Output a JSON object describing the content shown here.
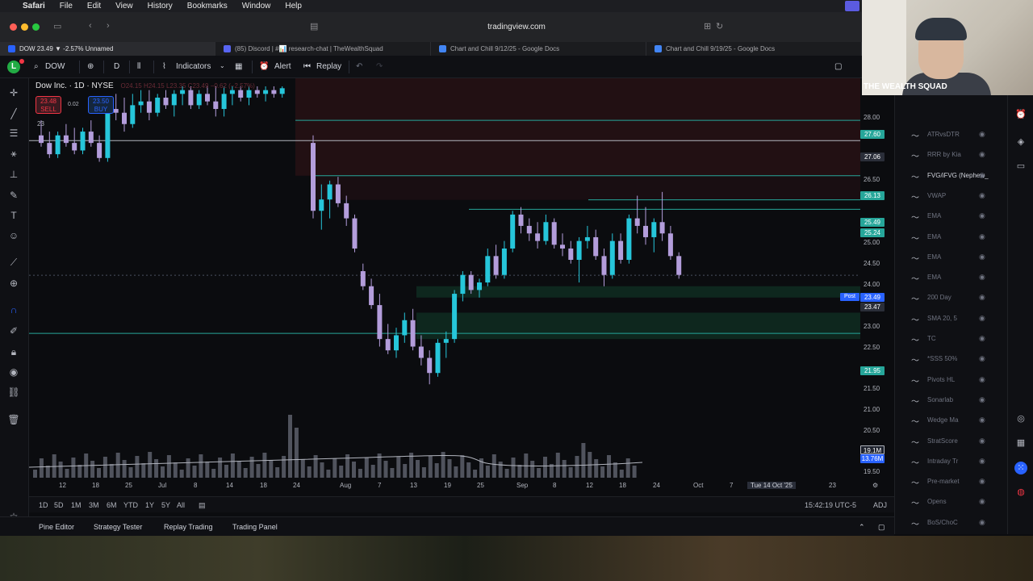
{
  "menubar": {
    "app": "Safari",
    "items": [
      "File",
      "Edit",
      "View",
      "History",
      "Bookmarks",
      "Window",
      "Help"
    ]
  },
  "safari": {
    "url": "tradingview.com"
  },
  "tabs": [
    {
      "label": "DOW 23.49 ▼ -2.57% Unnamed",
      "color": "#2962ff"
    },
    {
      "label": "(85) Discord | #📊 research-chat | TheWealthSquad",
      "color": "#5865f2"
    },
    {
      "label": "Chart and Chill 9/12/25 - Google Docs",
      "color": "#4285f4"
    },
    {
      "label": "Chart and Chill 9/19/25 - Google Docs",
      "color": "#4285f4"
    }
  ],
  "tv": {
    "avatar": "L",
    "symbol": "DOW",
    "interval": "D",
    "indicators": "Indicators",
    "alert": "Alert",
    "replay": "Replay"
  },
  "legend": {
    "name": "Dow Inc. · 1D · NYSE",
    "ohlc": "O24.15 H24.15 L23.35 C23.49 −0.62 (−2.57%)",
    "sell_price": "23.48",
    "sell_label": "SELL",
    "buy_price": "23.50",
    "buy_label": "BUY",
    "spread": "0.02",
    "vol": "23"
  },
  "price_scale": {
    "labels": [
      "28.00",
      "26.50",
      "25.00",
      "24.50",
      "24.00",
      "23.00",
      "22.50",
      "21.50",
      "21.00",
      "20.50",
      "19.50"
    ],
    "tags": [
      {
        "text": "27.60",
        "color": "#26a69a"
      },
      {
        "text": "27.06",
        "color": "#2a2e39"
      },
      {
        "text": "26.13",
        "color": "#26a69a"
      },
      {
        "text": "25.49",
        "color": "#26a69a"
      },
      {
        "text": "25.24",
        "color": "#26a69a"
      },
      {
        "text": "23.49",
        "color": "#2962ff"
      },
      {
        "text": "23.47",
        "color": "#2a2e39"
      },
      {
        "text": "21.95",
        "color": "#26a69a"
      },
      {
        "text": "19.1M",
        "color": "#1e222d"
      },
      {
        "text": "13.76M",
        "color": "#2962ff"
      }
    ],
    "post_label": "Post"
  },
  "time_axis": [
    "12",
    "18",
    "25",
    "Jul",
    "8",
    "14",
    "18",
    "24",
    "Aug",
    "7",
    "13",
    "19",
    "25",
    "Sep",
    "8",
    "12",
    "18",
    "24",
    "Oct",
    "7",
    "Tue 14 Oct '25",
    "23"
  ],
  "range_bar": {
    "ranges": [
      "1D",
      "5D",
      "1M",
      "3M",
      "6M",
      "YTD",
      "1Y",
      "5Y",
      "All"
    ],
    "clock": "15:42:19 UTC-5",
    "adj": "ADJ"
  },
  "bottom_panel": [
    "Pine Editor",
    "Strategy Tester",
    "Replay Trading",
    "Trading Panel"
  ],
  "object_tree": [
    {
      "name": "ATRvsDTR",
      "bright": false
    },
    {
      "name": "RRR by Kia",
      "bright": false
    },
    {
      "name": "FVG/iFVG (Nephew_",
      "bright": true
    },
    {
      "name": "VWAP",
      "bright": false
    },
    {
      "name": "EMA",
      "bright": false
    },
    {
      "name": "EMA",
      "bright": false
    },
    {
      "name": "EMA",
      "bright": false
    },
    {
      "name": "EMA",
      "bright": false
    },
    {
      "name": "200 Day",
      "bright": false
    },
    {
      "name": "SMA 20, 5",
      "bright": false
    },
    {
      "name": "TC",
      "bright": false
    },
    {
      "name": "*SSS 50%",
      "bright": false
    },
    {
      "name": "Pivots HL",
      "bright": false
    },
    {
      "name": "Sonarlab",
      "bright": false
    },
    {
      "name": "Wedge Ma",
      "bright": false
    },
    {
      "name": "StratScore",
      "bright": false
    },
    {
      "name": "Intraday Tr",
      "bright": false
    },
    {
      "name": "Pre-market",
      "bright": false
    },
    {
      "name": "Opens",
      "bright": false
    },
    {
      "name": "BoS/ChoC",
      "bright": false
    }
  ],
  "webcam": {
    "tag": "THE WEALTH SQUAD"
  },
  "colors": {
    "up": "#26c6da",
    "down": "#b39ddb",
    "level": "#26a69a",
    "bg": "#0b0c0f"
  },
  "chart_data": {
    "type": "candlestick",
    "ylim": [
      19.3,
      28.5
    ],
    "candles": [
      {
        "o": 27.2,
        "h": 27.6,
        "l": 26.9,
        "c": 27.0
      },
      {
        "o": 27.0,
        "h": 27.3,
        "l": 26.6,
        "c": 26.7
      },
      {
        "o": 26.7,
        "h": 27.3,
        "l": 26.6,
        "c": 27.2
      },
      {
        "o": 27.2,
        "h": 27.5,
        "l": 26.9,
        "c": 27.0
      },
      {
        "o": 27.0,
        "h": 27.4,
        "l": 26.7,
        "c": 26.8
      },
      {
        "o": 26.8,
        "h": 27.4,
        "l": 26.7,
        "c": 27.3
      },
      {
        "o": 27.3,
        "h": 27.6,
        "l": 26.9,
        "c": 27.0
      },
      {
        "o": 27.0,
        "h": 27.2,
        "l": 26.5,
        "c": 26.6
      },
      {
        "o": 26.6,
        "h": 28.0,
        "l": 26.5,
        "c": 27.9
      },
      {
        "o": 27.9,
        "h": 28.3,
        "l": 27.6,
        "c": 27.8
      },
      {
        "o": 27.8,
        "h": 28.2,
        "l": 27.3,
        "c": 27.5
      },
      {
        "o": 27.5,
        "h": 28.3,
        "l": 27.4,
        "c": 28.0
      },
      {
        "o": 28.0,
        "h": 28.4,
        "l": 27.8,
        "c": 28.1
      },
      {
        "o": 28.1,
        "h": 28.4,
        "l": 27.6,
        "c": 27.8
      },
      {
        "o": 27.8,
        "h": 28.3,
        "l": 27.7,
        "c": 28.2
      },
      {
        "o": 28.2,
        "h": 28.4,
        "l": 27.9,
        "c": 28.0
      },
      {
        "o": 28.0,
        "h": 28.4,
        "l": 27.7,
        "c": 28.3
      },
      {
        "o": 28.3,
        "h": 28.5,
        "l": 28.0,
        "c": 28.4
      },
      {
        "o": 28.4,
        "h": 28.5,
        "l": 27.9,
        "c": 28.0
      },
      {
        "o": 28.0,
        "h": 28.4,
        "l": 27.9,
        "c": 28.3
      },
      {
        "o": 28.3,
        "h": 28.5,
        "l": 28.0,
        "c": 28.1
      },
      {
        "o": 28.1,
        "h": 28.5,
        "l": 27.7,
        "c": 27.9
      },
      {
        "o": 27.9,
        "h": 28.5,
        "l": 27.7,
        "c": 28.3
      },
      {
        "o": 28.3,
        "h": 28.5,
        "l": 28.0,
        "c": 28.4
      },
      {
        "o": 28.4,
        "h": 28.5,
        "l": 28.1,
        "c": 28.2
      },
      {
        "o": 28.2,
        "h": 28.5,
        "l": 28.0,
        "c": 28.4
      },
      {
        "o": 28.4,
        "h": 28.5,
        "l": 28.2,
        "c": 28.3
      },
      {
        "o": 28.3,
        "h": 28.5,
        "l": 28.1,
        "c": 28.4
      },
      {
        "o": 28.4,
        "h": 28.5,
        "l": 28.2,
        "c": 28.3
      },
      {
        "o": 28.3,
        "h": 28.5,
        "l": 28.2,
        "c": 28.45
      },
      {
        "o": 27.0,
        "h": 27.2,
        "l": 25.0,
        "c": 25.2
      },
      {
        "o": 25.2,
        "h": 25.9,
        "l": 24.7,
        "c": 25.5
      },
      {
        "o": 25.5,
        "h": 26.0,
        "l": 25.0,
        "c": 25.9
      },
      {
        "o": 25.9,
        "h": 26.1,
        "l": 25.3,
        "c": 25.4
      },
      {
        "o": 25.4,
        "h": 25.6,
        "l": 24.8,
        "c": 25.0
      },
      {
        "o": 25.0,
        "h": 25.1,
        "l": 24.1,
        "c": 24.2
      },
      {
        "o": 23.6,
        "h": 23.8,
        "l": 23.1,
        "c": 23.2
      },
      {
        "o": 23.2,
        "h": 23.4,
        "l": 22.6,
        "c": 22.7
      },
      {
        "o": 22.7,
        "h": 23.0,
        "l": 21.6,
        "c": 21.8
      },
      {
        "o": 21.8,
        "h": 22.2,
        "l": 21.4,
        "c": 21.5
      },
      {
        "o": 21.5,
        "h": 22.1,
        "l": 21.3,
        "c": 21.9
      },
      {
        "o": 21.9,
        "h": 22.5,
        "l": 21.7,
        "c": 22.3
      },
      {
        "o": 22.3,
        "h": 22.6,
        "l": 21.5,
        "c": 21.6
      },
      {
        "o": 21.6,
        "h": 21.9,
        "l": 21.1,
        "c": 21.3
      },
      {
        "o": 21.3,
        "h": 21.5,
        "l": 20.6,
        "c": 20.9
      },
      {
        "o": 20.9,
        "h": 21.8,
        "l": 20.8,
        "c": 21.7
      },
      {
        "o": 21.7,
        "h": 22.0,
        "l": 21.3,
        "c": 21.8
      },
      {
        "o": 21.8,
        "h": 23.1,
        "l": 21.7,
        "c": 23.0
      },
      {
        "o": 23.0,
        "h": 23.6,
        "l": 22.8,
        "c": 23.5
      },
      {
        "o": 23.5,
        "h": 23.6,
        "l": 23.0,
        "c": 23.1
      },
      {
        "o": 23.1,
        "h": 23.4,
        "l": 22.9,
        "c": 23.3
      },
      {
        "o": 23.3,
        "h": 24.2,
        "l": 23.2,
        "c": 24.0
      },
      {
        "o": 24.0,
        "h": 24.3,
        "l": 23.4,
        "c": 23.5
      },
      {
        "o": 23.5,
        "h": 24.4,
        "l": 23.4,
        "c": 24.2
      },
      {
        "o": 24.2,
        "h": 25.2,
        "l": 24.1,
        "c": 25.1
      },
      {
        "o": 25.1,
        "h": 25.3,
        "l": 24.6,
        "c": 24.8
      },
      {
        "o": 24.8,
        "h": 25.0,
        "l": 24.4,
        "c": 24.6
      },
      {
        "o": 24.6,
        "h": 24.9,
        "l": 24.2,
        "c": 24.4
      },
      {
        "o": 24.4,
        "h": 25.1,
        "l": 24.3,
        "c": 24.9
      },
      {
        "o": 24.9,
        "h": 25.0,
        "l": 24.2,
        "c": 24.3
      },
      {
        "o": 24.3,
        "h": 24.6,
        "l": 24.0,
        "c": 24.2
      },
      {
        "o": 24.2,
        "h": 24.4,
        "l": 23.8,
        "c": 23.9
      },
      {
        "o": 23.9,
        "h": 24.5,
        "l": 23.3,
        "c": 24.4
      },
      {
        "o": 24.4,
        "h": 24.8,
        "l": 24.2,
        "c": 24.5
      },
      {
        "o": 24.5,
        "h": 24.7,
        "l": 23.9,
        "c": 24.0
      },
      {
        "o": 24.0,
        "h": 24.2,
        "l": 23.2,
        "c": 23.5
      },
      {
        "o": 23.5,
        "h": 24.6,
        "l": 23.4,
        "c": 24.4
      },
      {
        "o": 24.4,
        "h": 24.6,
        "l": 23.8,
        "c": 23.9
      },
      {
        "o": 23.9,
        "h": 25.1,
        "l": 23.8,
        "c": 25.0
      },
      {
        "o": 25.0,
        "h": 25.6,
        "l": 24.6,
        "c": 24.8
      },
      {
        "o": 24.8,
        "h": 25.3,
        "l": 24.3,
        "c": 24.5
      },
      {
        "o": 24.5,
        "h": 25.0,
        "l": 24.1,
        "c": 24.9
      },
      {
        "o": 24.9,
        "h": 25.7,
        "l": 24.4,
        "c": 24.6
      },
      {
        "o": 24.6,
        "h": 24.8,
        "l": 23.9,
        "c": 24.0
      },
      {
        "o": 24.0,
        "h": 24.1,
        "l": 23.4,
        "c": 23.5
      }
    ],
    "levels": [
      {
        "price": 27.6,
        "color": "#26a69a"
      },
      {
        "price": 27.06,
        "color": "#b2b5be"
      },
      {
        "price": 26.13,
        "color": "#26a69a"
      },
      {
        "price": 25.49,
        "color": "#26a69a"
      },
      {
        "price": 25.24,
        "color": "#26a69a"
      },
      {
        "price": 21.95,
        "color": "#26a69a"
      }
    ]
  }
}
